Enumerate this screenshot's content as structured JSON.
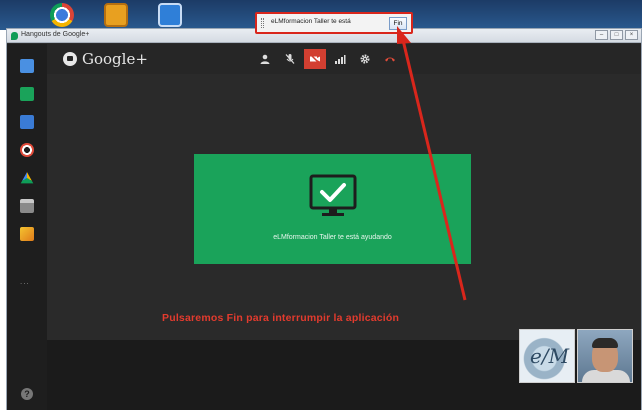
{
  "window": {
    "title": "Hangouts de Google+"
  },
  "sharing_bar": {
    "text": "eLMformacion Taller te está",
    "stop_button": "Fin"
  },
  "brand": {
    "logo_text": "Google+"
  },
  "call_controls": [
    {
      "name": "invite-people",
      "icon": "person-add-icon"
    },
    {
      "name": "mute-mic",
      "icon": "mic-off-icon"
    },
    {
      "name": "video-off",
      "icon": "camera-off-icon",
      "active": true
    },
    {
      "name": "bandwidth",
      "icon": "signal-bars-icon"
    },
    {
      "name": "settings",
      "icon": "gear-icon"
    },
    {
      "name": "hang-up",
      "icon": "phone-hangup-icon"
    }
  ],
  "sidebar": {
    "items": [
      "chat-icon",
      "screenshare-icon",
      "camera-icon",
      "lifebuoy-icon",
      "drive-icon",
      "app-icon",
      "photo-icon"
    ],
    "more": "...",
    "help": "?"
  },
  "screen_share": {
    "label": "eLMformacion Taller te está ayudando"
  },
  "annotation": {
    "text": "Pulsaremos Fin para interrumpir la aplicación"
  },
  "participants": [
    {
      "name": "logo-participant",
      "initials": "e/M"
    },
    {
      "name": "person-participant"
    }
  ],
  "colors": {
    "accent_red": "#d23f31",
    "share_green": "#1aa35a",
    "annotation_red": "#e33b2e"
  }
}
